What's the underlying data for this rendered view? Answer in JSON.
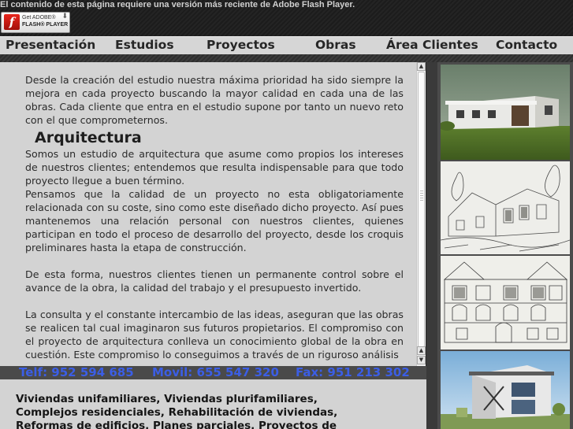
{
  "flash": {
    "message": "El contenido de esta página requiere una versión más reciente de Adobe Flash Player.",
    "badge_line1": "Get ADOBE®",
    "badge_line2": "FLASH® PLAYER",
    "logo_glyph": "f"
  },
  "nav": {
    "items": [
      "Presentación",
      "Estudios",
      "Proyectos",
      "Obras",
      "Área Clientes",
      "Contacto"
    ]
  },
  "content": {
    "intro": "Desde la creación del estudio nuestra máxima prioridad ha sido siempre la mejora en cada proyecto buscando la mayor calidad en cada una de las obras. Cada cliente que entra en el estudio supone por tanto un nuevo reto con el que comprometernos.",
    "heading": "Arquitectura",
    "para1": "Somos un estudio de arquitectura que asume como propios los intereses de nuestros clientes; entendemos que resulta indispensable para que todo proyecto llegue a buen término.",
    "para2": "Pensamos que la calidad de un proyecto no esta obligatoriamente relacionada con su coste, sino como este diseñado dicho proyecto. Así pues mantenemos una relación personal con nuestros clientes, quienes participan en todo el proceso de desarrollo del proyecto, desde los croquis preliminares hasta la etapa de construcción.",
    "para3": "De esta forma, nuestros clientes tienen un permanente control sobre el avance de la obra, la calidad del trabajo y el presupuesto invertido.",
    "para4": "La consulta y el constante intercambio de las ideas, aseguran que las obras se realicen tal cual imaginaron sus futuros propietarios. El compromiso con el proyecto de arquitectura conlleva un conocimiento global de la obra en cuestión. Este compromiso lo conseguimos a través de un riguroso análisis"
  },
  "contact": {
    "phone": "Telf: 952 594 685",
    "mobile": "Movil: 655 547 320",
    "fax": "Fax: 951 213 302"
  },
  "services": {
    "text": "Viviendas unifamiliares, Viviendas plurifamiliares, Complejos residenciales, Rehabilitación de viviendas, Reformas de edificios, Planes parciales, Proyectos de urbanización, Informes periciales"
  },
  "scrollbar": {
    "up_glyph": "▲",
    "down_glyph": "▼"
  },
  "colors": {
    "contact_text": "#3b5ee6",
    "flash_red": "#e8261c"
  },
  "gallery": {
    "icons": [
      "house-render-photo",
      "sketch-villa-photo",
      "sketch-facade-photo",
      "modern-house-render-photo"
    ]
  }
}
